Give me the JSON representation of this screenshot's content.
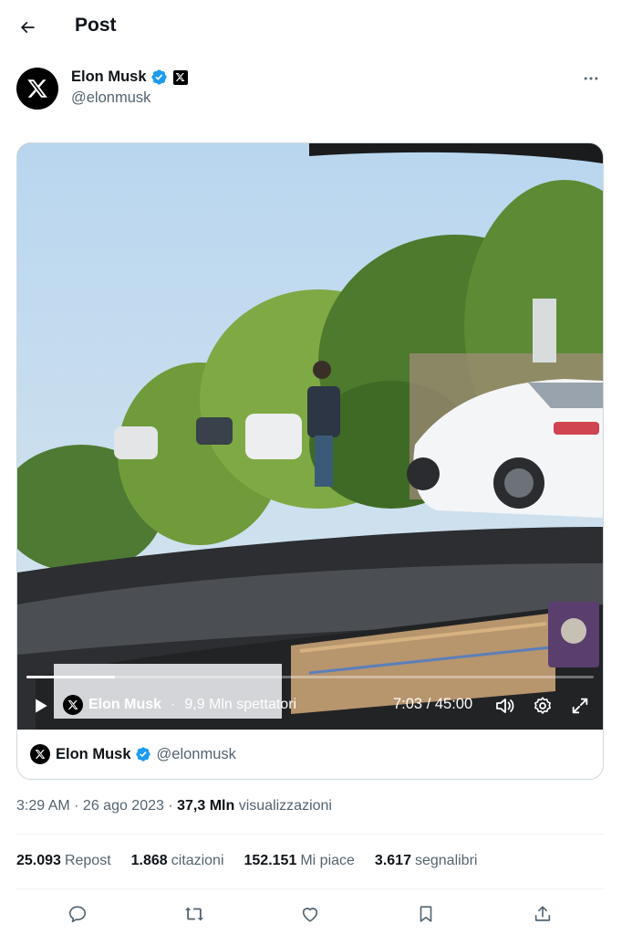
{
  "header": {
    "title": "Post"
  },
  "author": {
    "name": "Elon Musk",
    "handle": "@elonmusk"
  },
  "video": {
    "progress": 0.156,
    "author_name": "Elon Musk",
    "viewers": "9,9 Mln spettatori",
    "separator": "·",
    "time": "7:03 / 45:00"
  },
  "embed_footer": {
    "name": "Elon Musk",
    "handle": "@elonmusk"
  },
  "meta": {
    "time_date": "3:29 AM · 26 ago 2023 · ",
    "views_count": "37,3 Mln",
    "views_label": "visualizzazioni"
  },
  "stats": [
    {
      "num": "25.093",
      "label": "Repost"
    },
    {
      "num": "1.868",
      "label": "citazioni"
    },
    {
      "num": "152.151",
      "label": "Mi piace"
    },
    {
      "num": "3.617",
      "label": "segnalibri"
    }
  ],
  "colors": {
    "verified": "#1d9bf0",
    "text_secondary": "#536471",
    "border": "#cfd9de"
  },
  "icons": [
    "back-arrow-icon",
    "x-logo-icon",
    "verified-badge-icon",
    "more-icon",
    "play-icon",
    "volume-icon",
    "settings-icon",
    "fullscreen-icon",
    "reply-icon",
    "repost-icon",
    "like-icon",
    "bookmark-icon",
    "share-icon"
  ]
}
